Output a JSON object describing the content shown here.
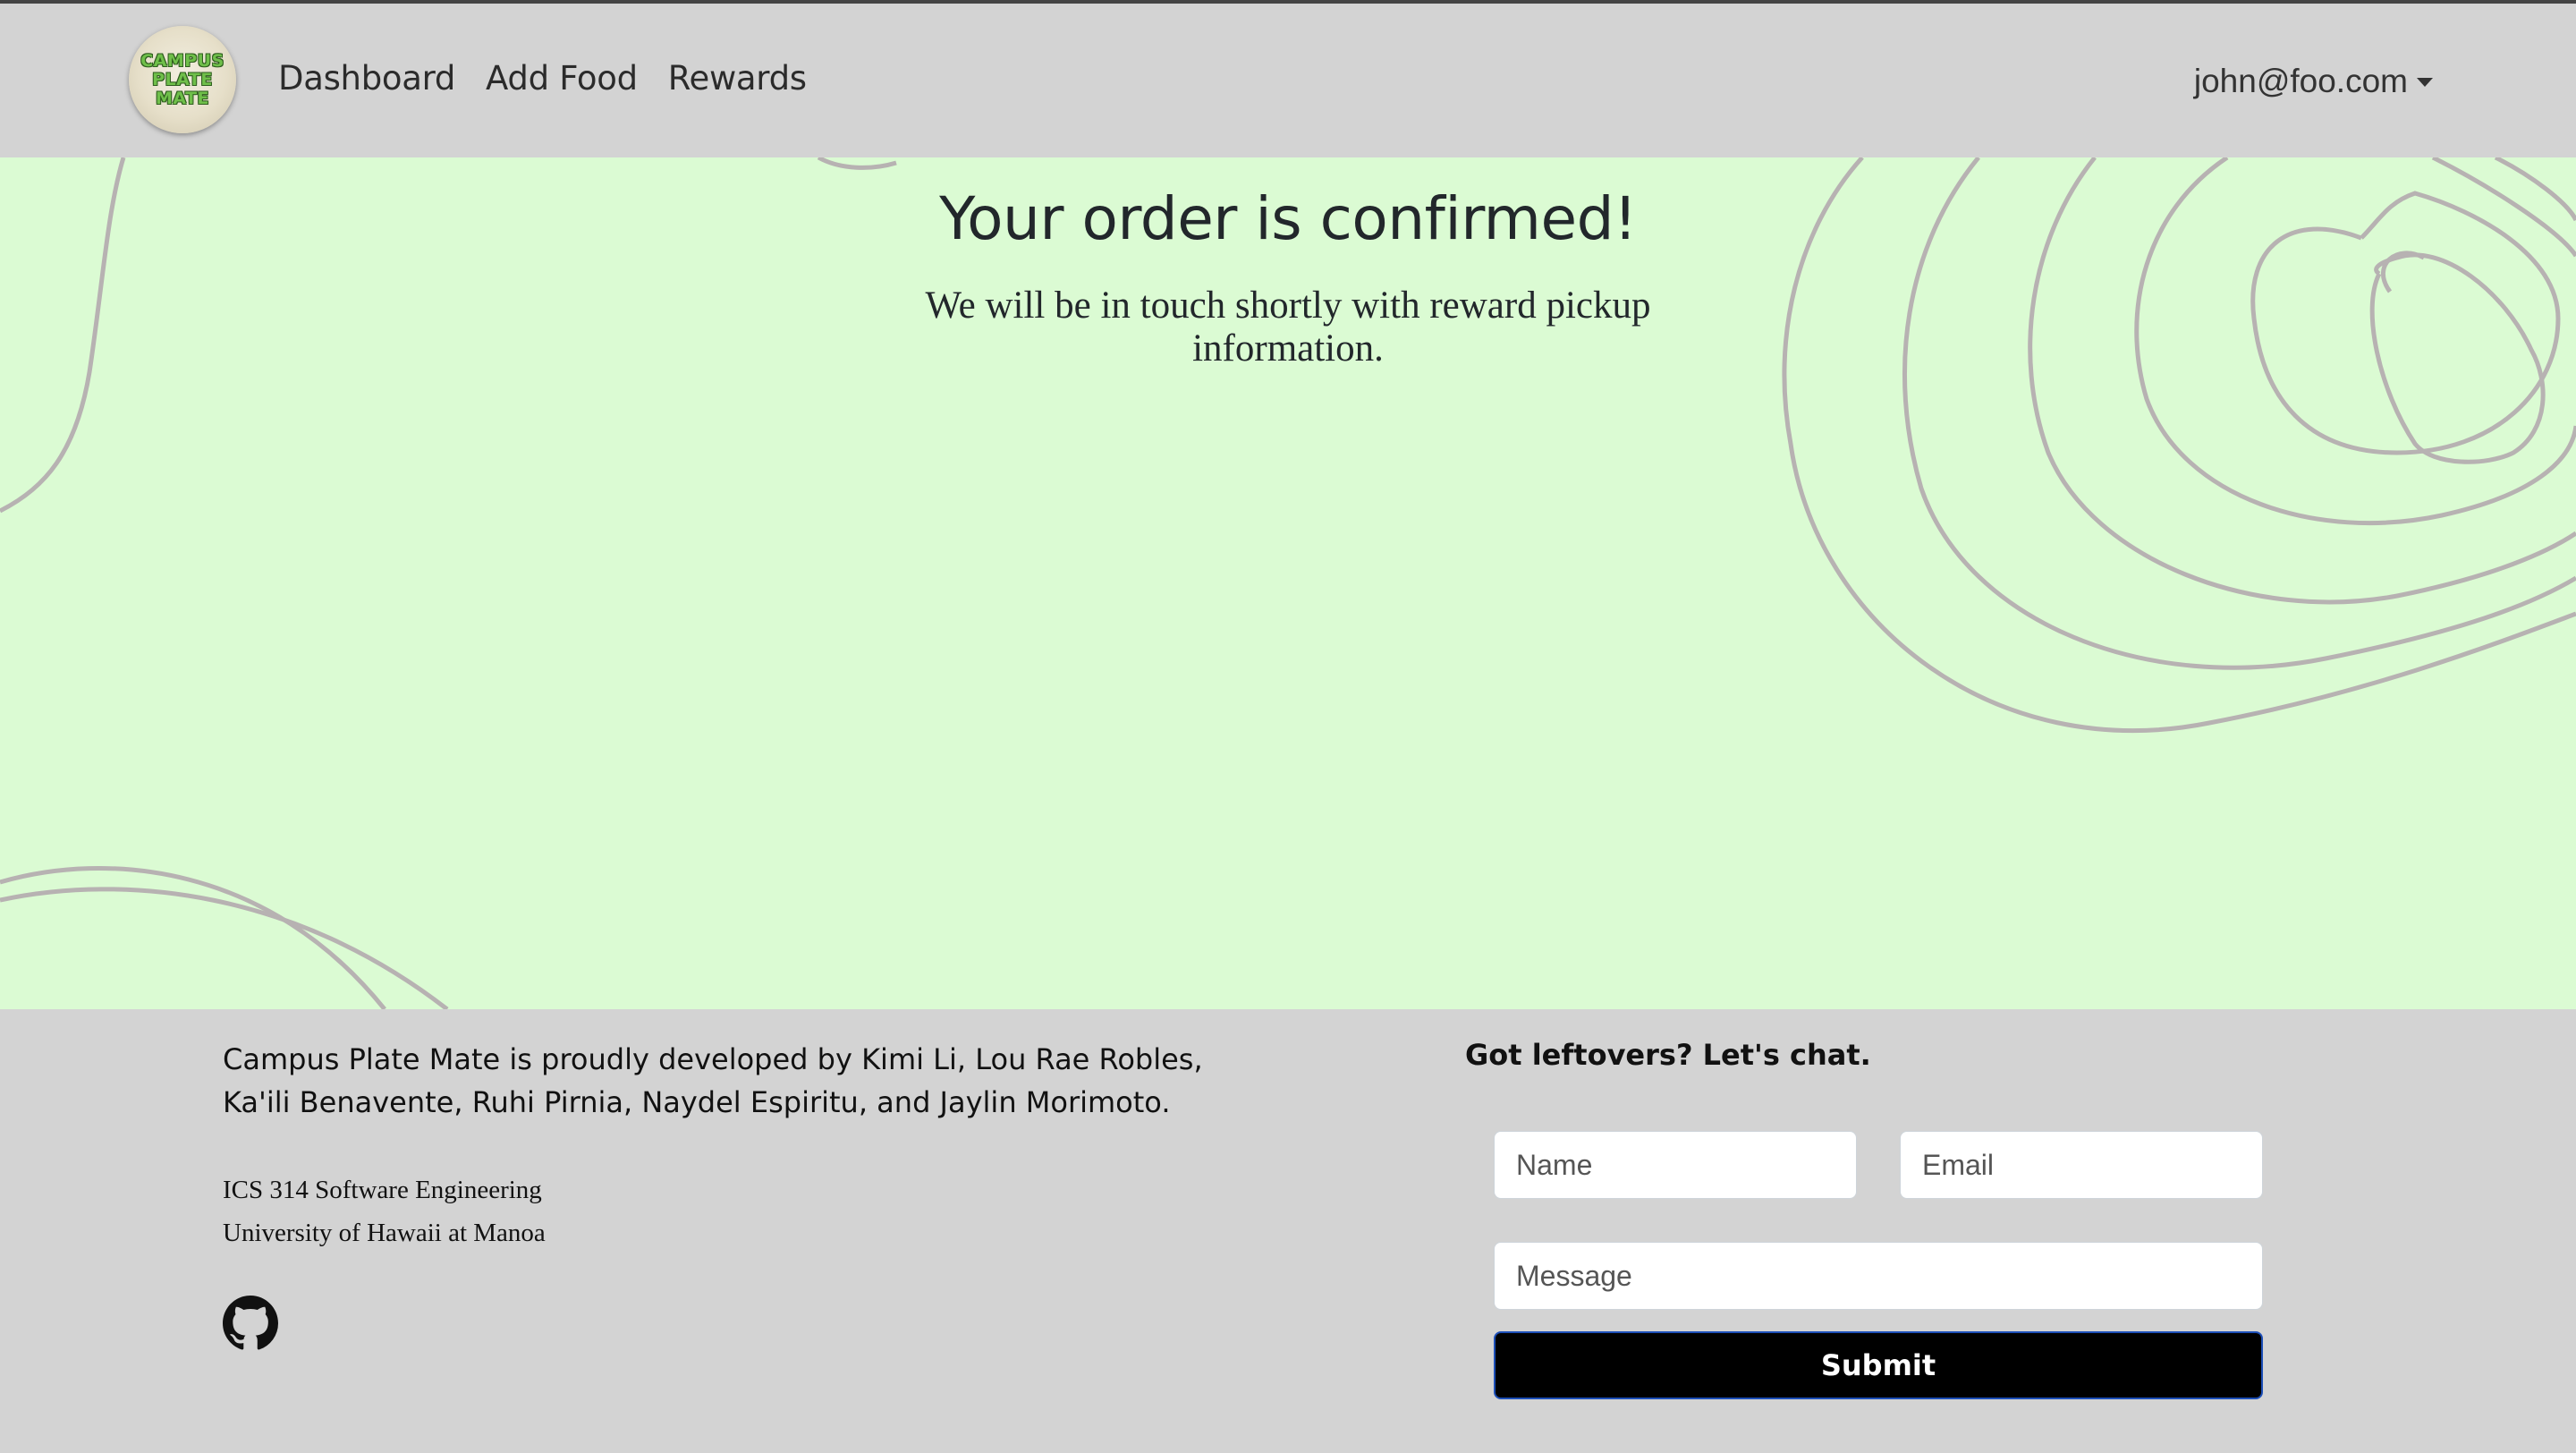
{
  "brand": {
    "logo_text_line1": "CAMPUS",
    "logo_text_line2": "PLATE",
    "logo_text_line3": "MATE"
  },
  "nav": {
    "links": [
      "Dashboard",
      "Add Food",
      "Rewards"
    ],
    "user_email": "john@foo.com"
  },
  "confirmation": {
    "title": "Your order is confirmed!",
    "subtitle": "We will be in touch shortly with reward pickup information."
  },
  "footer": {
    "credits": "Campus Plate Mate is proudly developed by Kimi Li, Lou Rae Robles, Ka'ili Benavente, Ruhi Pirnia, Naydel Espiritu, and Jaylin Morimoto.",
    "course_line1": "ICS 314 Software Engineering",
    "course_line2": "University of Hawaii at Manoa",
    "github_icon": "github-icon",
    "chat_title": "Got leftovers? Let's chat.",
    "form": {
      "name_placeholder": "Name",
      "email_placeholder": "Email",
      "message_placeholder": "Message",
      "submit_label": "Submit"
    }
  },
  "colors": {
    "navbar_bg": "#d3d3d3",
    "main_bg": "#dbfbd3",
    "contour_stroke": "#b7b2b2",
    "submit_bg": "#000000"
  }
}
